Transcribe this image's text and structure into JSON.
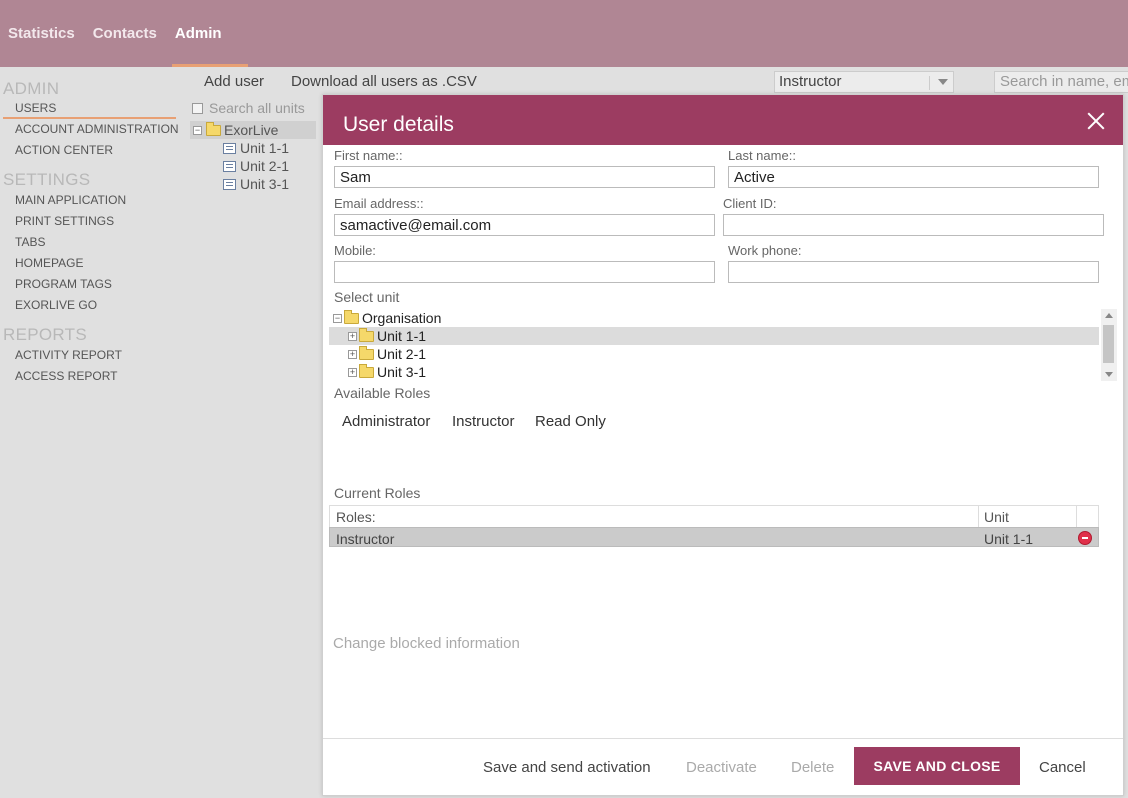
{
  "topnav": {
    "items": [
      {
        "label": "Statistics"
      },
      {
        "label": "Contacts"
      },
      {
        "label": "Admin"
      }
    ]
  },
  "sidebar": {
    "admin_title": "ADMIN",
    "admin_items": [
      "USERS",
      "ACCOUNT ADMINISTRATION",
      "ACTION CENTER"
    ],
    "settings_title": "SETTINGS",
    "settings_items": [
      "MAIN APPLICATION",
      "PRINT SETTINGS",
      "TABS",
      "HOMEPAGE",
      "PROGRAM TAGS",
      "EXORLIVE GO"
    ],
    "reports_title": "REPORTS",
    "reports_items": [
      "ACTIVITY REPORT",
      "ACCESS REPORT"
    ]
  },
  "toolbar": {
    "add_user": "Add user",
    "download_csv": "Download all users as .CSV",
    "role_filter": "Instructor",
    "search_placeholder": "Search in name, em"
  },
  "tree": {
    "search_all_units": "Search all units",
    "root": "ExorLive",
    "children": [
      "Unit 1-1",
      "Unit 2-1",
      "Unit 3-1"
    ]
  },
  "modal": {
    "title": "User details",
    "first_name_label": "First name::",
    "first_name_value": "Sam",
    "last_name_label": "Last name::",
    "last_name_value": "Active",
    "email_label": "Email address::",
    "email_value": "samactive@email.com",
    "client_id_label": "Client ID:",
    "client_id_value": "",
    "mobile_label": "Mobile:",
    "mobile_value": "",
    "work_phone_label": "Work phone:",
    "work_phone_value": "",
    "select_unit_label": "Select unit",
    "unit_tree": {
      "root": "Organisation",
      "children": [
        "Unit 1-1",
        "Unit 2-1",
        "Unit 3-1"
      ]
    },
    "available_roles_label": "Available Roles",
    "available_roles": [
      "Administrator",
      "Instructor",
      "Read Only"
    ],
    "current_roles_label": "Current Roles",
    "roles_table": {
      "col_roles": "Roles:",
      "col_unit": "Unit",
      "rows": [
        {
          "role": "Instructor",
          "unit": "Unit 1-1"
        }
      ]
    },
    "change_blocked": "Change blocked information",
    "footer": {
      "save_send": "Save and send activation",
      "deactivate": "Deactivate",
      "delete": "Delete",
      "save_close": "SAVE AND CLOSE",
      "cancel": "Cancel"
    }
  },
  "colors": {
    "topbar": "#b08694",
    "accent": "#9c3c61",
    "active_underline": "#e8a074"
  }
}
